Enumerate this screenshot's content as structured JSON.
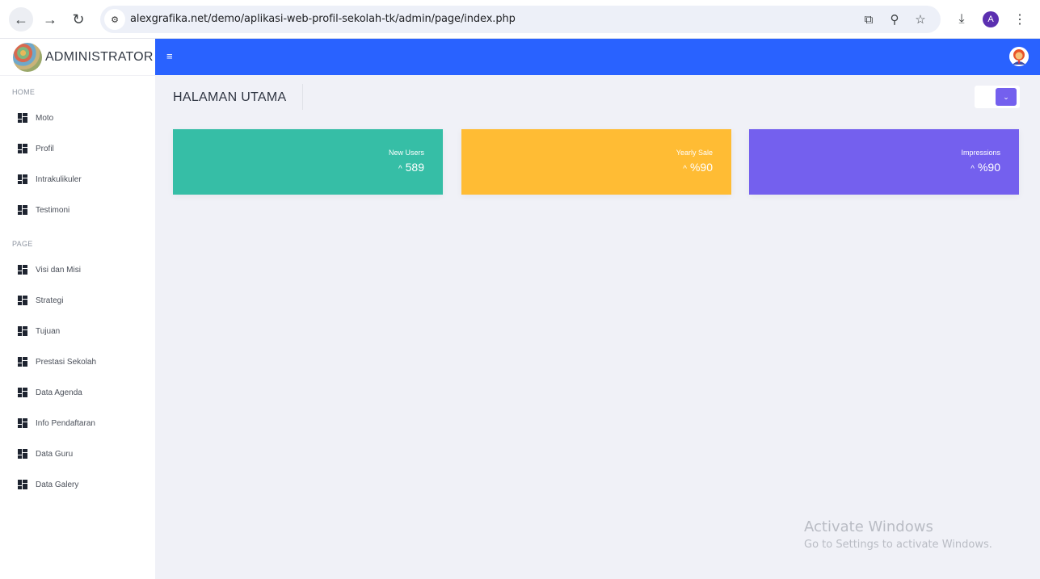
{
  "browser": {
    "url": "alexgrafika.net/demo/aplikasi-web-profil-sekolah-tk/admin/page/index.php",
    "profile_initial": "A",
    "icons": {
      "back": "←",
      "forward": "→",
      "reload": "↻",
      "site_info": "⚙",
      "translate": "⧉",
      "zoom": "⚲",
      "bookmark": "☆",
      "download": "⤓",
      "menu": "⋮"
    }
  },
  "sidebar": {
    "brand": "ADMINISTRATOR",
    "sections": [
      {
        "label": "HOME",
        "items": [
          {
            "label": "Moto"
          },
          {
            "label": "Profil"
          },
          {
            "label": "Intrakulikuler"
          },
          {
            "label": "Testimoni"
          }
        ]
      },
      {
        "label": "PAGE",
        "items": [
          {
            "label": "Visi dan Misi"
          },
          {
            "label": "Strategi"
          },
          {
            "label": "Tujuan"
          },
          {
            "label": "Prestasi Sekolah"
          },
          {
            "label": "Data Agenda"
          },
          {
            "label": "Info Pendaftaran"
          },
          {
            "label": "Data Guru"
          },
          {
            "label": "Data Galery"
          }
        ]
      }
    ]
  },
  "topbar": {
    "menu_icon": "≡",
    "brand_color": "#2962ff"
  },
  "main": {
    "page_title": "HALAMAN UTAMA",
    "dropdown_icon": "⌄",
    "stats": [
      {
        "label": "New Users",
        "arrow": "^",
        "value": "589",
        "color": "#36bea6"
      },
      {
        "label": "Yearly Sale",
        "arrow": "^",
        "value": "%90",
        "color": "#ffbc34"
      },
      {
        "label": "Impressions",
        "arrow": "^",
        "value": "%90",
        "color": "#7460ee"
      }
    ]
  },
  "watermark": {
    "title": "Activate Windows",
    "subtitle": "Go to Settings to activate Windows."
  }
}
